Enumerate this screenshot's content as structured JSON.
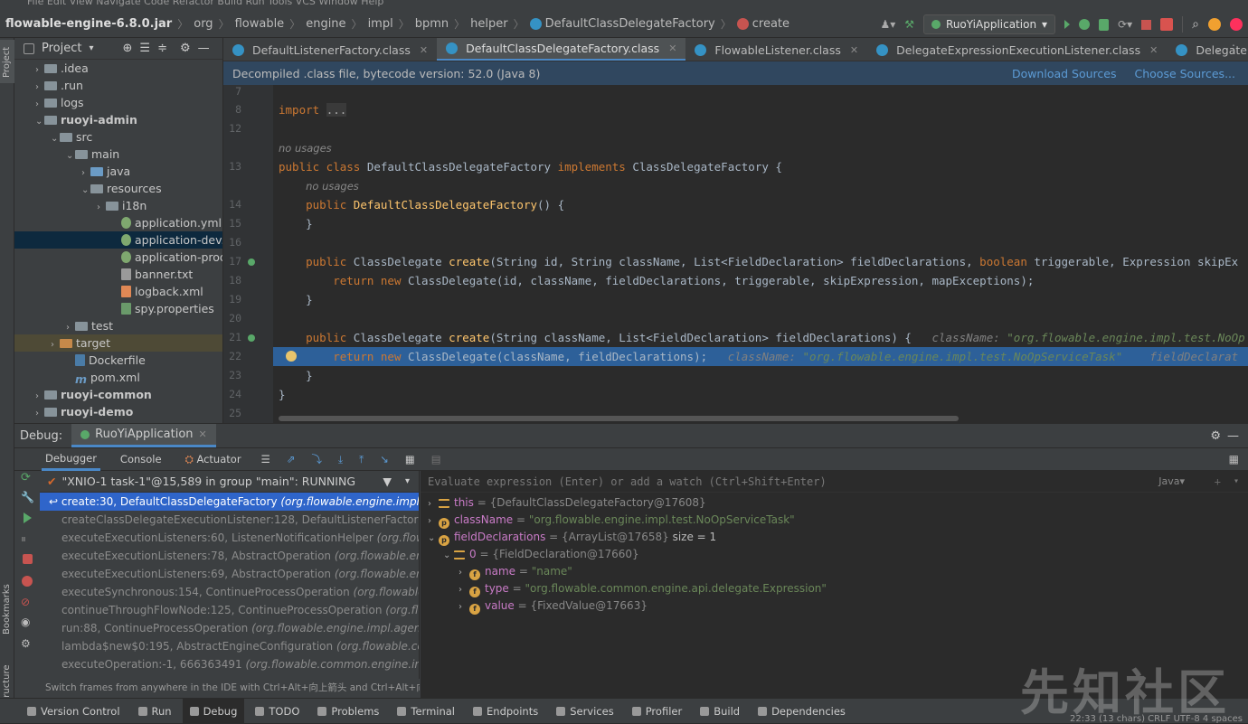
{
  "nav": {
    "crumbs": [
      "flowable-engine-6.8.0.jar",
      "org",
      "flowable",
      "engine",
      "impl",
      "bpmn",
      "helper",
      "DefaultClassDelegateFactory",
      "create"
    ]
  },
  "run_config": "RuoYiApplication",
  "project": {
    "title": "Project",
    "tree": [
      {
        "label": ".idea",
        "depth": 1,
        "arrow": "›",
        "icon": "folder"
      },
      {
        "label": ".run",
        "depth": 1,
        "arrow": "›",
        "icon": "folder"
      },
      {
        "label": "logs",
        "depth": 1,
        "arrow": "›",
        "icon": "folder"
      },
      {
        "label": "ruoyi-admin",
        "depth": 1,
        "arrow": "⌄",
        "icon": "folder",
        "bold": true
      },
      {
        "label": "src",
        "depth": 2,
        "arrow": "⌄",
        "icon": "folder"
      },
      {
        "label": "main",
        "depth": 3,
        "arrow": "⌄",
        "icon": "folder"
      },
      {
        "label": "java",
        "depth": 4,
        "arrow": "›",
        "icon": "folder-blue"
      },
      {
        "label": "resources",
        "depth": 4,
        "arrow": "⌄",
        "icon": "folder"
      },
      {
        "label": "i18n",
        "depth": 5,
        "arrow": "›",
        "icon": "folder"
      },
      {
        "label": "application.yml",
        "depth": 6,
        "arrow": "",
        "icon": "yml"
      },
      {
        "label": "application-dev.yml",
        "depth": 6,
        "arrow": "",
        "icon": "yml",
        "selected": true
      },
      {
        "label": "application-prod.yml",
        "depth": 6,
        "arrow": "",
        "icon": "yml"
      },
      {
        "label": "banner.txt",
        "depth": 6,
        "arrow": "",
        "icon": "txt"
      },
      {
        "label": "logback.xml",
        "depth": 6,
        "arrow": "",
        "icon": "xml"
      },
      {
        "label": "spy.properties",
        "depth": 6,
        "arrow": "",
        "icon": "prop"
      },
      {
        "label": "test",
        "depth": 3,
        "arrow": "›",
        "icon": "folder"
      },
      {
        "label": "target",
        "depth": 2,
        "arrow": "›",
        "icon": "folder-brown",
        "target": true
      },
      {
        "label": "Dockerfile",
        "depth": 3,
        "arrow": "",
        "icon": "doc"
      },
      {
        "label": "pom.xml",
        "depth": 3,
        "arrow": "",
        "icon": "pom"
      },
      {
        "label": "ruoyi-common",
        "depth": 1,
        "arrow": "›",
        "icon": "folder",
        "bold": true
      },
      {
        "label": "ruoyi-demo",
        "depth": 1,
        "arrow": "›",
        "icon": "folder",
        "bold": true
      }
    ]
  },
  "editor": {
    "tabs": [
      {
        "label": "DefaultListenerFactory.class",
        "active": false
      },
      {
        "label": "DefaultClassDelegateFactory.class",
        "active": true
      },
      {
        "label": "FlowableListener.class",
        "active": false
      },
      {
        "label": "DelegateExpressionExecutionListener.class",
        "active": false
      },
      {
        "label": "DelegateExecutionListener.c",
        "active": false
      }
    ],
    "banner": "Decompiled .class file, bytecode version: 52.0 (Java 8)",
    "banner_links": [
      "Download Sources",
      "Choose Sources..."
    ],
    "lines": [
      {
        "n": "7",
        "html": ""
      },
      {
        "n": "8",
        "html": "<span class=\"kw\">import</span> <span style=\"background:#3a3a3a;color:#aaa\">...</span>"
      },
      {
        "n": "12",
        "html": ""
      },
      {
        "n": "",
        "html": "<span class=\"hint\">no usages</span>",
        "hint": true
      },
      {
        "n": "13",
        "html": "<span class=\"kw\">public class</span> DefaultClassDelegateFactory <span class=\"kw\">implements</span> ClassDelegateFactory {"
      },
      {
        "n": "",
        "html": "    <span class=\"hint\">no usages</span>",
        "hint": true
      },
      {
        "n": "14",
        "html": "    <span class=\"kw\">public</span> <span class=\"fn\">DefaultClassDelegateFactory</span>() {"
      },
      {
        "n": "15",
        "html": "    }"
      },
      {
        "n": "16",
        "html": ""
      },
      {
        "n": "17",
        "html": "    <span class=\"kw\">public</span> ClassDelegate <span class=\"fn\">create</span>(String id, String className, List&lt;FieldDeclaration&gt; fieldDeclarations, <span class=\"kw\">boolean</span> triggerable, Expression skipEx"
      },
      {
        "n": "18",
        "html": "        <span class=\"kw\">return new</span> ClassDelegate(id, className, fieldDeclarations, triggerable, skipExpression, mapExceptions);"
      },
      {
        "n": "19",
        "html": "    }"
      },
      {
        "n": "20",
        "html": ""
      },
      {
        "n": "21",
        "html": "    <span class=\"kw\">public</span> ClassDelegate <span class=\"fn\">create</span>(String className, List&lt;FieldDeclaration&gt; fieldDeclarations) {   <span class=\"inl\">className: <span class=\"v\">\"org.flowable.engine.impl.test.NoOp</span></span>"
      },
      {
        "n": "22",
        "html": "        <span class=\"kw\">return new</span> ClassDelegate(className, fieldDeclarations);   <span class=\"inl\">className: <span class=\"v\">\"org.flowable.engine.impl.test.NoOpServiceTask\"</span>    fieldDeclarat</span>",
        "current": true
      },
      {
        "n": "23",
        "html": "    }"
      },
      {
        "n": "24",
        "html": "}"
      },
      {
        "n": "25",
        "html": ""
      }
    ]
  },
  "debug": {
    "title": "Debug:",
    "session": "RuoYiApplication",
    "tabs": [
      "Debugger",
      "Console",
      "Actuator"
    ],
    "thread": "\"XNIO-1 task-1\"@15,589 in group \"main\": RUNNING",
    "frames": [
      {
        "method": "create:30, DefaultClassDelegateFactory",
        "pkg": "(org.flowable.engine.impl.bpmn",
        "selected": true
      },
      {
        "method": "createClassDelegateExecutionListener:128, DefaultListenerFactory",
        "pkg": "(o"
      },
      {
        "method": "executeExecutionListeners:60, ListenerNotificationHelper",
        "pkg": "(org.flowa"
      },
      {
        "method": "executeExecutionListeners:78, AbstractOperation",
        "pkg": "(org.flowable.engi"
      },
      {
        "method": "executeExecutionListeners:69, AbstractOperation",
        "pkg": "(org.flowable.engi"
      },
      {
        "method": "executeSynchronous:154, ContinueProcessOperation",
        "pkg": "(org.flowable.e"
      },
      {
        "method": "continueThroughFlowNode:125, ContinueProcessOperation",
        "pkg": "(org.flo"
      },
      {
        "method": "run:88, ContinueProcessOperation",
        "pkg": "(org.flowable.engine.impl.agenda"
      },
      {
        "method": "lambda$new$0:195, AbstractEngineConfiguration",
        "pkg": "(org.flowable.com"
      },
      {
        "method": "executeOperation:-1, 666363491",
        "pkg": "(org.flowable.common.engine.impl"
      }
    ],
    "frame_tip": "Switch frames from anywhere in the IDE with Ctrl+Alt+向上箭头 and Ctrl+Alt+向",
    "eval_placeholder": "Evaluate expression (Enter) or add a watch (Ctrl+Shift+Enter)",
    "eval_lang": "Java",
    "vars": [
      {
        "depth": 0,
        "arrow": "›",
        "icon": "lines",
        "name": "this",
        "eq": " = ",
        "val": "{DefaultClassDelegateFactory@17608}",
        "kind": "obj"
      },
      {
        "depth": 0,
        "arrow": "›",
        "icon": "p",
        "name": "className",
        "eq": " = ",
        "val": "\"org.flowable.engine.impl.test.NoOpServiceTask\"",
        "kind": "str"
      },
      {
        "depth": 0,
        "arrow": "⌄",
        "icon": "p",
        "name": "fieldDeclarations",
        "eq": " = ",
        "val": "{ArrayList@17658}",
        "kind": "obj",
        "extra": "  size = 1"
      },
      {
        "depth": 1,
        "arrow": "⌄",
        "icon": "lines",
        "name": "0",
        "eq": " = ",
        "val": "{FieldDeclaration@17660}",
        "kind": "obj"
      },
      {
        "depth": 2,
        "arrow": "›",
        "icon": "f",
        "name": "name",
        "eq": " = ",
        "val": "\"name\"",
        "kind": "str"
      },
      {
        "depth": 2,
        "arrow": "›",
        "icon": "f",
        "name": "type",
        "eq": " = ",
        "val": "\"org.flowable.common.engine.api.delegate.Expression\"",
        "kind": "str"
      },
      {
        "depth": 2,
        "arrow": "›",
        "icon": "f",
        "name": "value",
        "eq": " = ",
        "val": "{FixedValue@17663}",
        "kind": "obj"
      }
    ]
  },
  "side_labels": {
    "project": "Project",
    "bookmarks": "Bookmarks",
    "structure": "Structure"
  },
  "statusbar": [
    "Version Control",
    "Run",
    "Debug",
    "TODO",
    "Problems",
    "Terminal",
    "Endpoints",
    "Services",
    "Profiler",
    "Build",
    "Dependencies"
  ],
  "statusbar_active": "Debug",
  "status_right": "22:33 (13 chars)   CRLF   UTF-8   4 spaces",
  "watermark": "先知社区"
}
